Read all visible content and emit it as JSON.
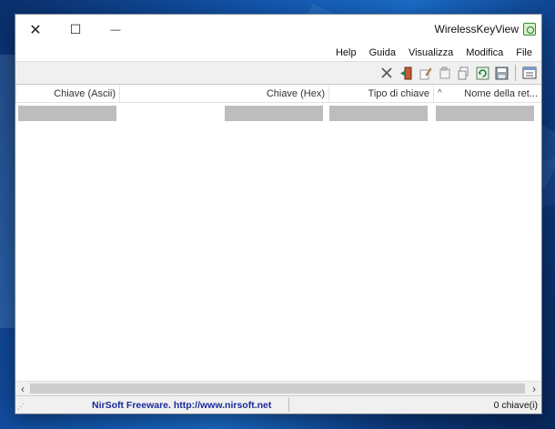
{
  "window": {
    "title": "WirelessKeyView",
    "caption_close": "✕",
    "caption_maximize": "☐",
    "caption_minimize": "—"
  },
  "menu": {
    "items": [
      "File",
      "Modifica",
      "Visualizza",
      "Guida",
      "Help"
    ]
  },
  "toolbar": {
    "icons": [
      "properties-icon",
      "save-icon",
      "refresh-icon",
      "copy-icon",
      "copy-alt-icon",
      "edit-icon",
      "exit-icon",
      "delete-icon"
    ]
  },
  "list": {
    "columns": [
      {
        "label": "Nome della ret...",
        "sorted": true
      },
      {
        "label": "Tipo di chiave"
      },
      {
        "label": "Chiave (Hex)"
      },
      {
        "label": "Chiave (Ascii)"
      }
    ],
    "sort_indicator": "^"
  },
  "status": {
    "count": "0 chiave(i)",
    "credit": "NirSoft Freeware.  http://www.nirsoft.net",
    "credit_color": "#1a2a9a"
  }
}
